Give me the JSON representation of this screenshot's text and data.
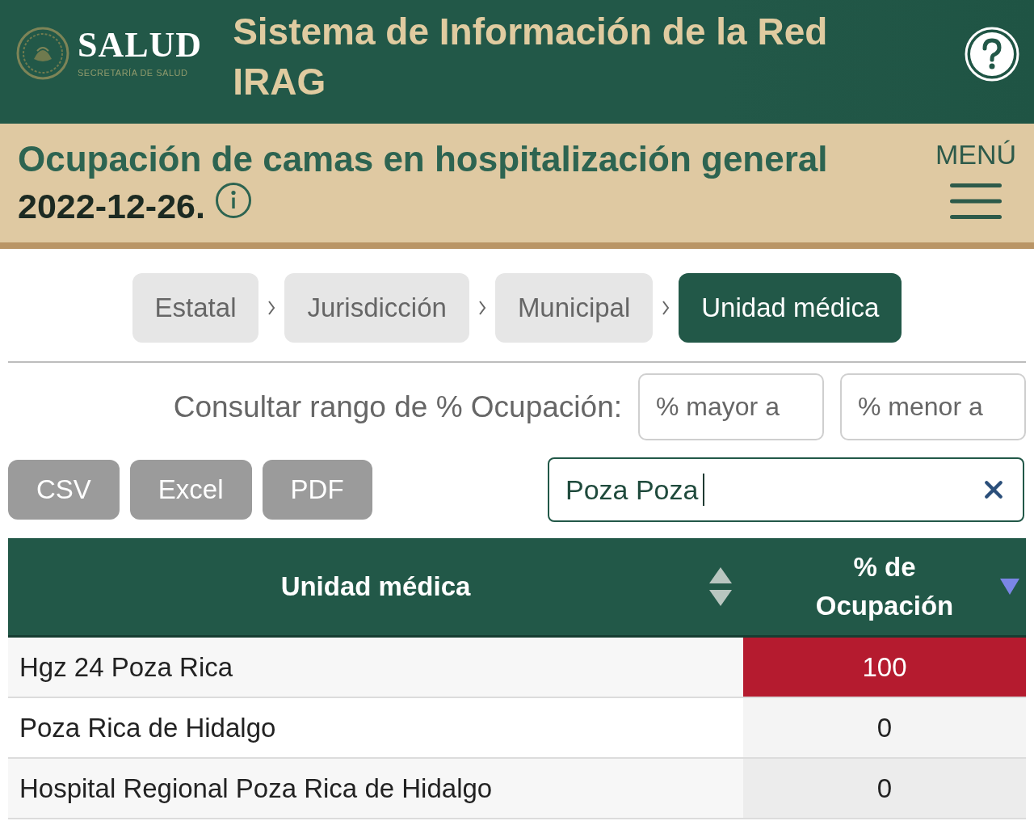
{
  "header": {
    "logo_title": "SALUD",
    "logo_subtitle": "SECRETARÍA DE SALUD",
    "title": "Sistema de Información de la Red IRAG"
  },
  "banner": {
    "title": "Ocupación de camas en hospitalización general",
    "date": "2022-12-26.",
    "menu_label": "MENÚ"
  },
  "breadcrumbs": [
    {
      "label": "Estatal",
      "selected": false
    },
    {
      "label": "Jurisdicción",
      "selected": false
    },
    {
      "label": "Municipal",
      "selected": false
    },
    {
      "label": "Unidad médica",
      "selected": true
    }
  ],
  "range_filter": {
    "label": "Consultar rango de % Ocupación:",
    "min_placeholder": "% mayor a",
    "max_placeholder": "% menor a"
  },
  "export_buttons": [
    "CSV",
    "Excel",
    "PDF"
  ],
  "search": {
    "value": "Poza Poza"
  },
  "table": {
    "sort_descending": true,
    "columns": [
      {
        "label": "Unidad médica",
        "sorted": false
      },
      {
        "label": "% de Ocupación",
        "sorted": true
      }
    ],
    "rows": [
      {
        "unit": "Hgz 24 Poza Rica",
        "occupancy": "100",
        "color": "#b51b2f"
      },
      {
        "unit": "Poza Rica de Hidalgo",
        "occupancy": "0"
      },
      {
        "unit": "Hospital Regional Poza Rica de Hidalgo",
        "occupancy": "0"
      }
    ]
  }
}
